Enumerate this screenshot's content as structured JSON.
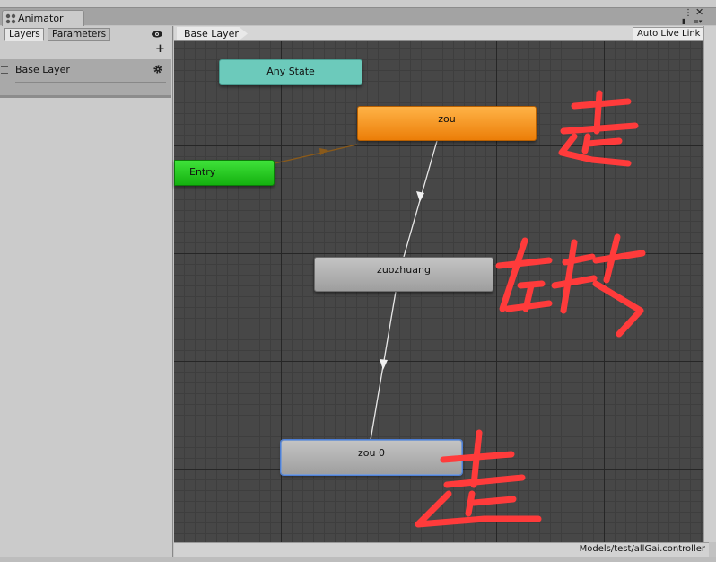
{
  "window": {
    "tab_title": "Animator",
    "icon": "animator-icon",
    "controls": [
      "lock-icon",
      "menu-icon",
      "close-icon"
    ]
  },
  "left_panel": {
    "tabs": [
      {
        "label": "Layers",
        "active": true
      },
      {
        "label": "Parameters",
        "active": false
      }
    ],
    "eye_icon": "eye-icon",
    "add_icon": "plus-icon",
    "layers": [
      {
        "name": "Base Layer",
        "icon": "gear-icon"
      }
    ]
  },
  "breadcrumb": {
    "items": [
      "Base Layer"
    ],
    "auto_live_link": "Auto Live Link"
  },
  "graph": {
    "states": [
      {
        "id": "any-state",
        "label": "Any State",
        "color": "#6ccabb"
      },
      {
        "id": "zou",
        "label": "zou",
        "color": "#f29120"
      },
      {
        "id": "entry",
        "label": "Entry",
        "color": "#22c11c"
      },
      {
        "id": "zuozhuang",
        "label": "zuozhuang",
        "color": "#b0b0b0"
      },
      {
        "id": "zou-0",
        "label": "zou 0",
        "color": "#b0b0b0",
        "selected": true
      }
    ],
    "annotations": {
      "color": "#ff3b3b",
      "words": [
        "走",
        "左转",
        "走"
      ]
    }
  },
  "status": {
    "path": "Models/test/allGai.controller"
  }
}
